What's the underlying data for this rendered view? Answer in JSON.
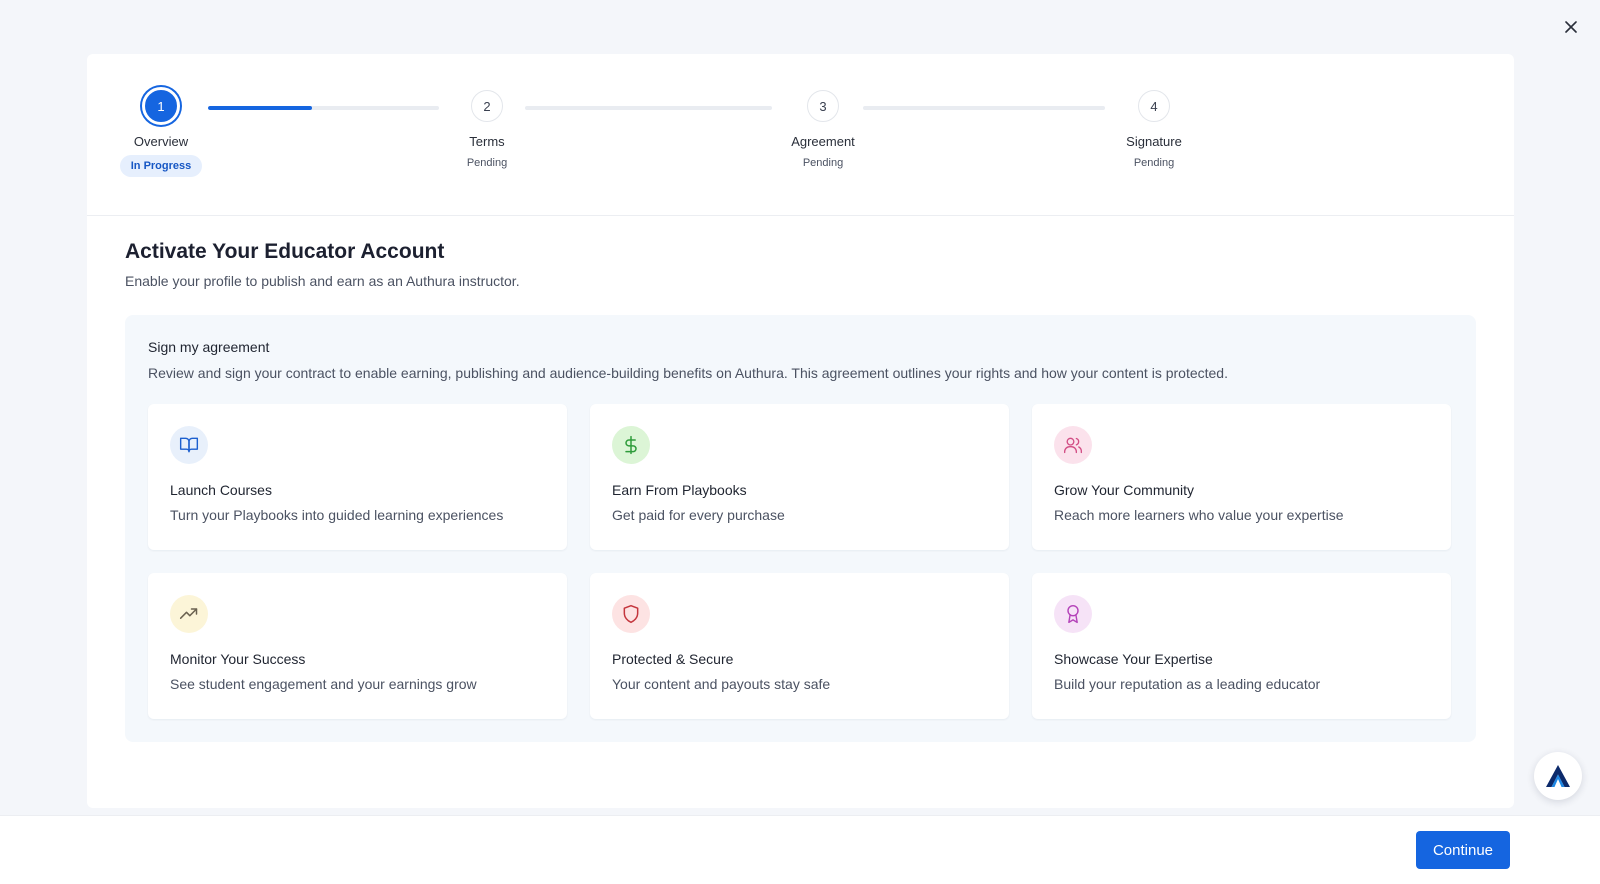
{
  "colors": {
    "primary": "#1565e0",
    "icon_bg_blue": "#e8f0fb",
    "icon_bg_green": "#dcf5d6",
    "icon_bg_pink": "#fbe2ec",
    "icon_bg_yellow": "#fcf5d8",
    "icon_bg_red": "#fde3e3",
    "icon_bg_purple": "#f6e3f7"
  },
  "stepper": {
    "progress_fraction": 0.45,
    "steps": [
      {
        "number": "1",
        "label": "Overview",
        "status": "In Progress"
      },
      {
        "number": "2",
        "label": "Terms",
        "status": "Pending"
      },
      {
        "number": "3",
        "label": "Agreement",
        "status": "Pending"
      },
      {
        "number": "4",
        "label": "Signature",
        "status": "Pending"
      }
    ]
  },
  "page": {
    "title": "Activate Your Educator Account",
    "subtitle": "Enable your profile to publish and earn as an Authura instructor."
  },
  "agreement": {
    "title": "Sign my agreement",
    "description": "Review and sign your contract to enable earning, publishing and audience-building benefits on Authura. This agreement outlines your rights and how your content is protected.",
    "cards": [
      {
        "icon": "book-open-icon",
        "title": "Launch Courses",
        "description": "Turn your Playbooks into guided learning experiences"
      },
      {
        "icon": "dollar-icon",
        "title": "Earn From Playbooks",
        "description": "Get paid for every purchase"
      },
      {
        "icon": "users-icon",
        "title": "Grow Your Community",
        "description": "Reach more learners who value your expertise"
      },
      {
        "icon": "trending-up-icon",
        "title": "Monitor Your Success",
        "description": "See student engagement and your earnings grow"
      },
      {
        "icon": "shield-icon",
        "title": "Protected & Secure",
        "description": "Your content and payouts stay safe"
      },
      {
        "icon": "award-icon",
        "title": "Showcase Your Expertise",
        "description": "Build your reputation as a leading educator"
      }
    ]
  },
  "footer": {
    "continue_label": "Continue"
  }
}
